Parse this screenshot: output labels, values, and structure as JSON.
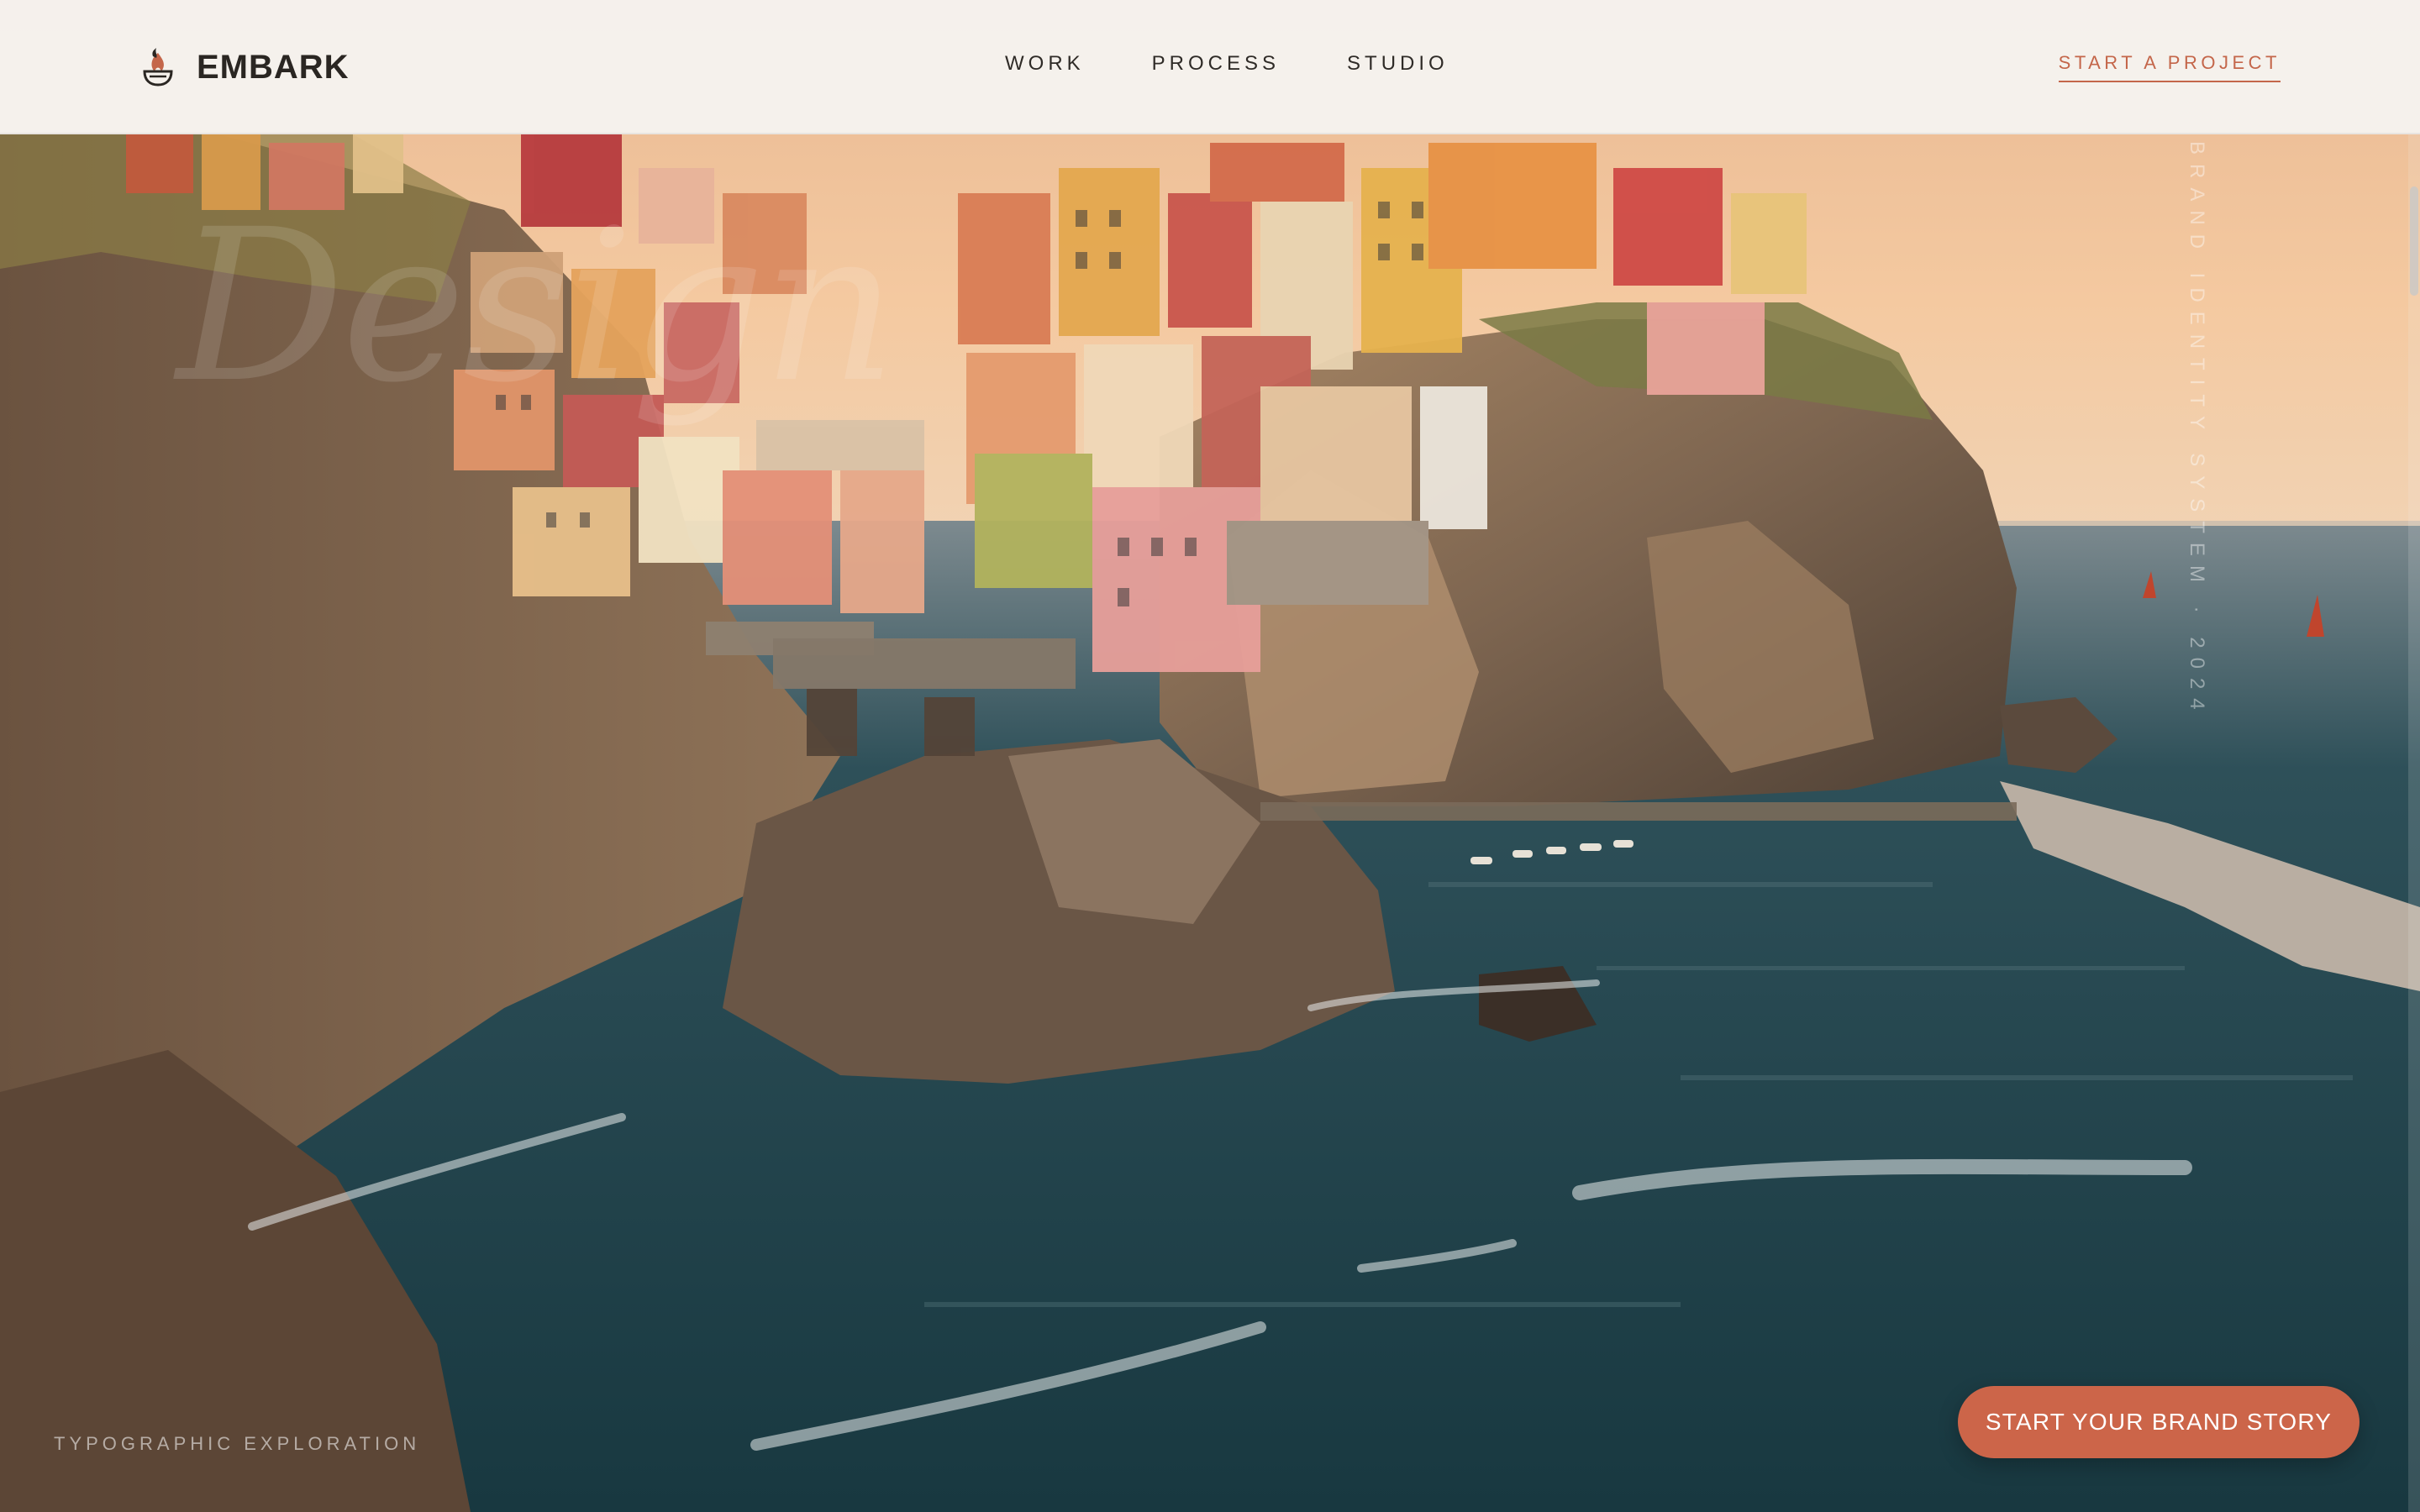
{
  "header": {
    "brand_name": "EMBARK",
    "brand_icon": "fire-bowl-icon",
    "nav": [
      {
        "label": "WORK"
      },
      {
        "label": "PROCESS"
      },
      {
        "label": "STUDIO"
      }
    ],
    "cta_label": "START A PROJECT"
  },
  "hero": {
    "ghost_word": "Design",
    "vertical_caption": "BRAND IDENTITY SYSTEM · 2024",
    "bottom_caption": "TYPOGRAPHIC EXPLORATION",
    "button_label": "START YOUR BRAND STORY"
  },
  "colors": {
    "accent": "#cc6549",
    "header_bg": "#f5f3ef",
    "text_dark": "#2a2622"
  }
}
